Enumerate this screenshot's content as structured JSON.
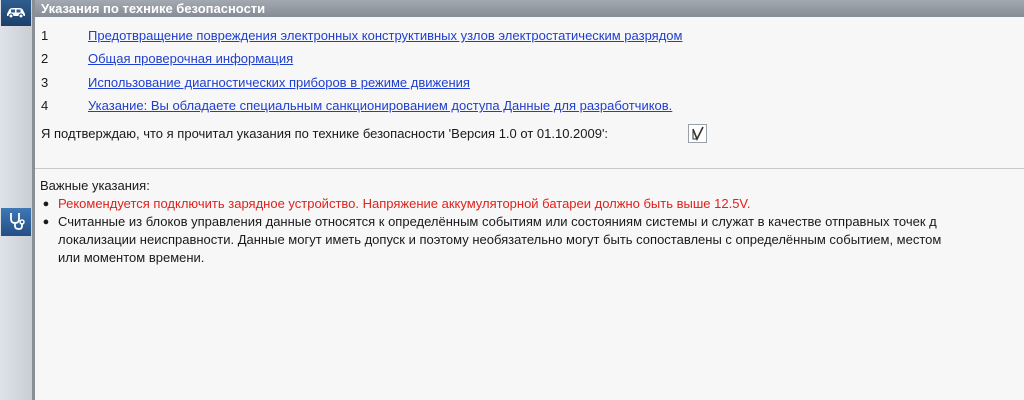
{
  "header": {
    "title": "Указания по технике безопасности"
  },
  "items": [
    {
      "number": "1",
      "label": "Предотвращение повреждения электронных конструктивных узлов электростатическим разрядом"
    },
    {
      "number": "2",
      "label": "Общая проверочная информация"
    },
    {
      "number": "3",
      "label": "Использование диагностических приборов в режиме движения"
    },
    {
      "number": "4",
      "label": "Указание: Вы обладаете специальным санкционированием доступа Данные для разработчиков."
    }
  ],
  "confirmation": {
    "text": "Я подтверждаю, что я прочитал указания по технике безопасности 'Версия 1.0 от 01.10.2009':",
    "checkbox_mark": "✓"
  },
  "notes": {
    "title": "Важные указания:",
    "bullets": [
      {
        "lines": [
          "Рекомендуется подключить зарядное устройство. Напряжение аккумуляторной батареи должно быть выше 12.5V."
        ],
        "color": "#e0221b"
      },
      {
        "lines": [
          "Считанные из блоков управления данные относятся к определённым событиям или состояниям системы и служат в качестве отправных точек д",
          "локализации неисправности. Данные могут иметь допуск и поэтому необязательно могут быть сопоставлены с определённым событием, местом",
          "или моментом времени."
        ],
        "color": "#1a1a1a"
      }
    ]
  },
  "sidebar": {
    "icons": [
      "car-icon",
      "stethoscope-icon"
    ]
  },
  "colors": {
    "header_bg": "#8e949c",
    "link": "#1f3fd0",
    "warning": "#e0221b"
  }
}
